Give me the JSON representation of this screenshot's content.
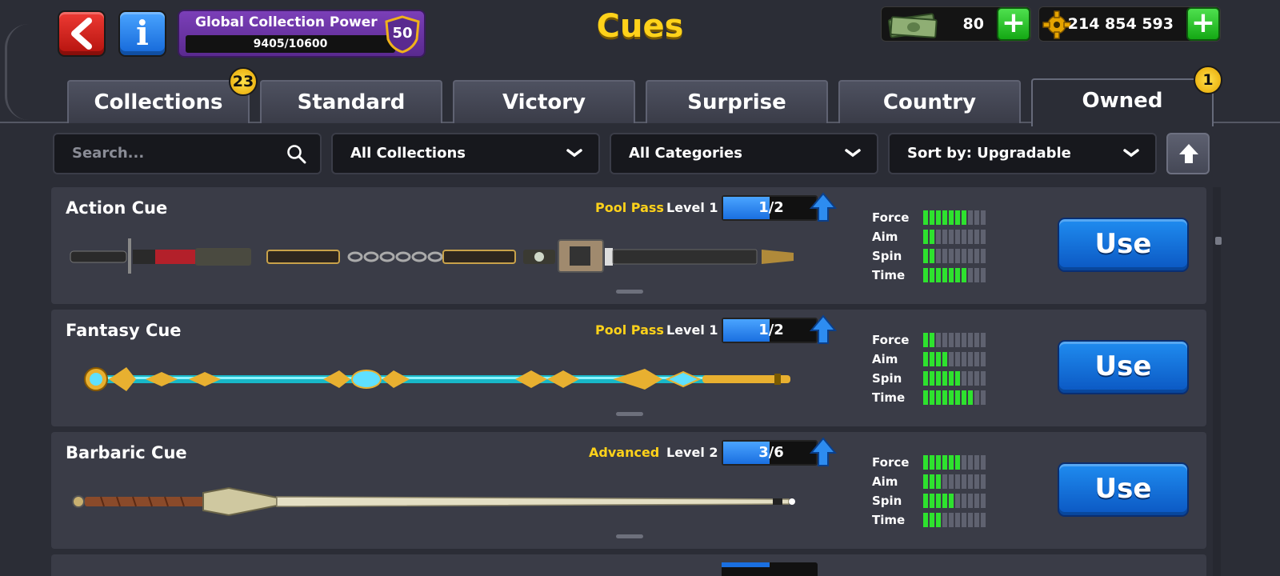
{
  "header": {
    "title": "Cues",
    "global_collection_power": {
      "label": "Global Collection Power",
      "progress_text": "9405/10600",
      "progress_fraction": 0.887,
      "level": "50"
    },
    "cash": "80",
    "coins": "214 854 593"
  },
  "tabs": [
    {
      "label": "Collections",
      "badge": "23"
    },
    {
      "label": "Standard"
    },
    {
      "label": "Victory"
    },
    {
      "label": "Surprise"
    },
    {
      "label": "Country"
    },
    {
      "label": "Owned",
      "badge": "1",
      "active": true
    }
  ],
  "filters": {
    "search_placeholder": "Search...",
    "collections": "All Collections",
    "categories": "All Categories",
    "sort": "Sort by: Upgradable"
  },
  "cues": [
    {
      "name": "Action Cue",
      "tag": "Pool Pass",
      "level": "Level 1",
      "progress_text": "1/2",
      "progress_fraction": 0.5,
      "stats": {
        "force": 7,
        "aim": 2,
        "spin": 2,
        "time": 7
      },
      "use_label": "Use"
    },
    {
      "name": "Fantasy Cue",
      "tag": "Pool Pass",
      "level": "Level 1",
      "progress_text": "1/2",
      "progress_fraction": 0.5,
      "stats": {
        "force": 2,
        "aim": 4,
        "spin": 6,
        "time": 8
      },
      "use_label": "Use"
    },
    {
      "name": "Barbaric Cue",
      "tag": "Advanced",
      "level": "Level 2",
      "progress_text": "3/6",
      "progress_fraction": 0.5,
      "stats": {
        "force": 6,
        "aim": 3,
        "spin": 5,
        "time": 3
      },
      "use_label": "Use"
    }
  ],
  "stat_labels": {
    "force": "Force",
    "aim": "Aim",
    "spin": "Spin",
    "time": "Time"
  },
  "stat_max": 10,
  "colors": {
    "accent_yellow": "#ffd21a",
    "use_blue": "#1a6fe0",
    "stat_green": "#2ee22e",
    "background": "#2b2d36"
  }
}
